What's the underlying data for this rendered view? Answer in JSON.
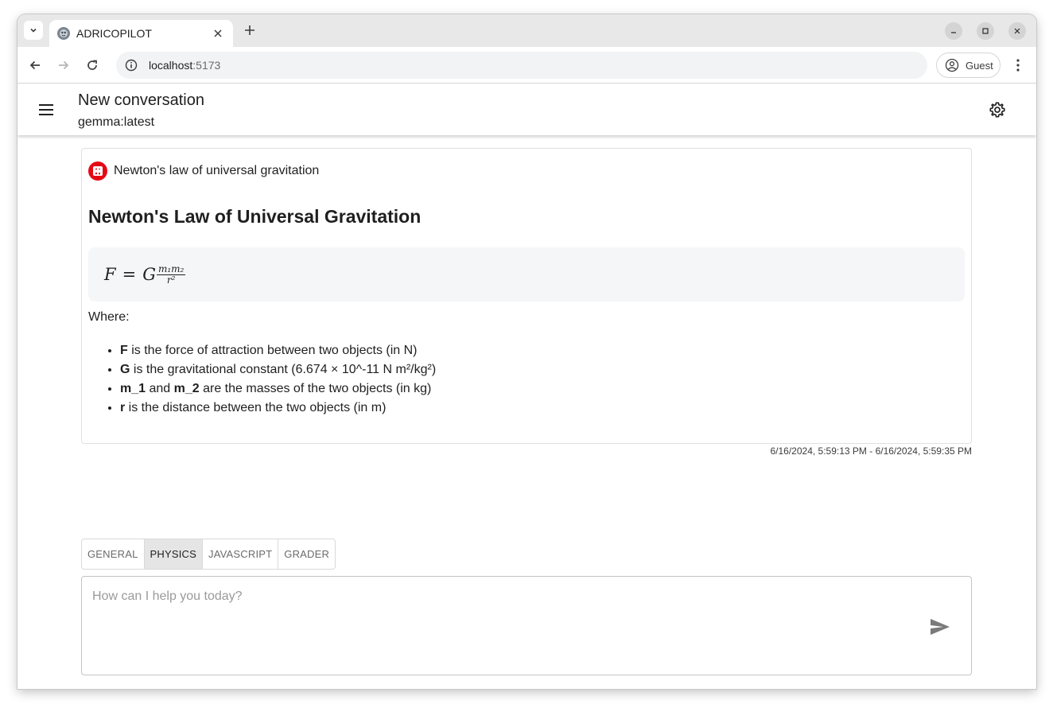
{
  "browser": {
    "tab_title": "ADRICOPILOT",
    "url_host": "localhost",
    "url_port": ":5173",
    "profile_label": "Guest"
  },
  "header": {
    "title": "New conversation",
    "model": "gemma:latest"
  },
  "message": {
    "subject": "Newton's law of universal gravitation",
    "heading": "Newton's Law of Universal Gravitation",
    "formula": {
      "lhs": "F",
      "equals": "=",
      "constant": "G",
      "numerator": "m₁m₂",
      "denominator": "r²"
    },
    "where_label": "Where:",
    "definitions": [
      {
        "term": "F",
        "text": " is the force of attraction between two objects (in N)"
      },
      {
        "term": "G",
        "text": " is the gravitational constant (6.674 × 10^-11 N m²/kg²)"
      },
      {
        "term": "m_1",
        "joiner": " and ",
        "term2": "m_2",
        "text": " are the masses of the two objects (in kg)"
      },
      {
        "term": "r",
        "text": " is the distance between the two objects (in m)"
      }
    ],
    "timestamp": "6/16/2024, 5:59:13 PM - 6/16/2024, 5:59:35 PM"
  },
  "persona_tabs": [
    {
      "label": "GENERAL",
      "active": false
    },
    {
      "label": "PHYSICS",
      "active": true
    },
    {
      "label": "JAVASCRIPT",
      "active": false
    },
    {
      "label": "GRADER",
      "active": false
    }
  ],
  "composer": {
    "placeholder": "How can I help you today?",
    "value": ""
  },
  "icons": {
    "persona_color": "#e50914",
    "accent": "#1f1f1f"
  }
}
